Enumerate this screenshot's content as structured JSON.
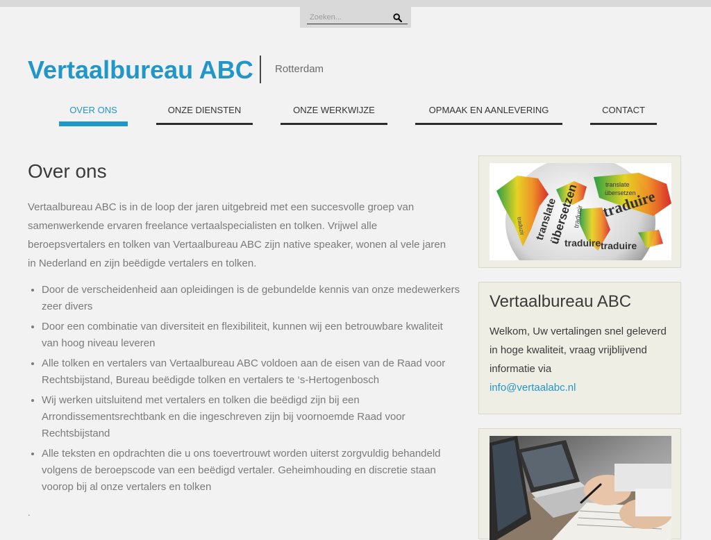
{
  "search": {
    "placeholder": "Zoeken..."
  },
  "header": {
    "site_title": "Vertaalbureau ABC",
    "tagline": "Rotterdam"
  },
  "nav": {
    "items": [
      {
        "label": "OVER ONS"
      },
      {
        "label": "ONZE DIENSTEN"
      },
      {
        "label": "ONZE WERKWIJZE"
      },
      {
        "label": "OPMAAK EN AANLEVERING"
      },
      {
        "label": "CONTACT"
      }
    ]
  },
  "main": {
    "heading": "Over ons",
    "intro": "Vertaalbureau ABC is in de loop der jaren uitgebreid met een succesvolle groep van samenwerkende ervaren freelance vertaalspecialisten en tolken. Vrijwel alle beroepsvertalers en tolken van Vertaalbureau ABC zijn native speaker, wonen al vele jaren in Nederland en zijn beëdigde vertalers en tolken.",
    "points": [
      "Door de verscheidenheid aan opleidingen is de gebundelde kennis van onze medewerkers zeer divers",
      "Door een combinatie van diversiteit en flexibiliteit, kunnen wij een betrouwbare kwaliteit van hoog niveau leveren",
      "Alle tolken en vertalers van Vertaalbureau ABC voldoen aan de eisen van de Raad voor Rechtsbijstand, Bureau beëdigde tolken en vertalers te ‘s-Hertogenbosch",
      "Wij werken uitsluitend met vertalers en tolken die beëdigd zijn bij een Arrondissementsrechtbank en die ingeschreven zijn bij voornoemde Raad voor Rechtsbijstand",
      "Alle teksten en opdrachten die u ons toevertrouwt worden uiterst zorgvuldig behandeld volgens de beroepscode van een beëdigd vertaler. Geheimhouding en discretie staan voorop bij al onze vertalers en tolken"
    ],
    "trailing": "."
  },
  "sidebar": {
    "image1_words": [
      "translate",
      "übersetzen",
      "traduire",
      "traducir",
      "traduzir"
    ],
    "heading": "Vertaalbureau ABC",
    "text": "Welkom, Uw vertalingen snel geleverd in hoge kwaliteit, vraag vrijblijvend informatie via",
    "email": "info@vertaalabc.nl"
  },
  "colors": {
    "accent": "#2196c9",
    "background": "#f2f2f2",
    "panel": "#eeeee4"
  }
}
